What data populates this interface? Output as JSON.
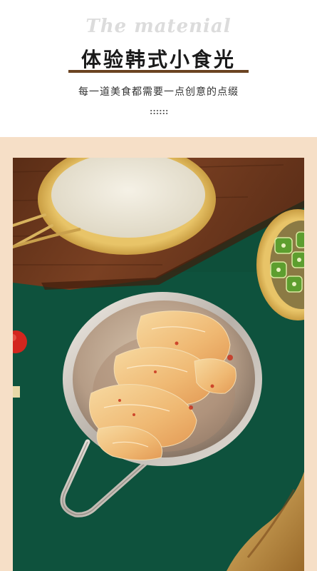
{
  "header": {
    "script_title": "The matenial",
    "main_title": "体验韩式小食光",
    "subtitle": "每一道美食都需要一点创意的点缀"
  },
  "colors": {
    "brand_brown": "#6b4422",
    "band_peach": "#f6dfc7",
    "board_green": "#0e4f3a"
  }
}
